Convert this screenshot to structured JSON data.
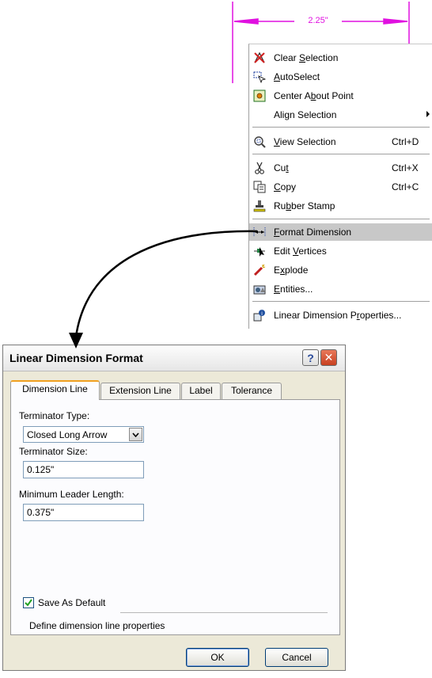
{
  "dimension": {
    "text": "2.25\"",
    "line_color": "#e010e0"
  },
  "context_menu": {
    "items": [
      {
        "label_pre": "Clear ",
        "label_ul": "S",
        "label_post": "election",
        "shortcut": "",
        "icon": "clear-selection-icon"
      },
      {
        "label_pre": "",
        "label_ul": "A",
        "label_post": "utoSelect",
        "shortcut": "",
        "icon": "autoselect-icon"
      },
      {
        "label_pre": "Center A",
        "label_ul": "b",
        "label_post": "out Point",
        "shortcut": "",
        "icon": "center-point-icon"
      },
      {
        "label_pre": "Ali",
        "label_ul": "g",
        "label_post": "n Selection",
        "shortcut": "",
        "icon": "",
        "submenu": true
      },
      {
        "label_pre": "",
        "label_ul": "V",
        "label_post": "iew Selection",
        "shortcut": "Ctrl+D",
        "icon": "view-selection-icon"
      },
      {
        "label_pre": "Cu",
        "label_ul": "t",
        "label_post": "",
        "shortcut": "Ctrl+X",
        "icon": "scissors-icon"
      },
      {
        "label_pre": "",
        "label_ul": "C",
        "label_post": "opy",
        "shortcut": "Ctrl+C",
        "icon": "copy-icon"
      },
      {
        "label_pre": "Ru",
        "label_ul": "b",
        "label_post": "ber Stamp",
        "shortcut": "",
        "icon": "stamp-icon"
      },
      {
        "label_pre": "",
        "label_ul": "F",
        "label_post": "ormat Dimension",
        "shortcut": "",
        "icon": "format-dimension-icon",
        "highlighted": true
      },
      {
        "label_pre": "Edit ",
        "label_ul": "V",
        "label_post": "ertices",
        "shortcut": "",
        "icon": "edit-vertices-icon"
      },
      {
        "label_pre": "E",
        "label_ul": "x",
        "label_post": "plode",
        "shortcut": "",
        "icon": "explode-icon"
      },
      {
        "label_pre": "",
        "label_ul": "E",
        "label_post": "ntities...",
        "shortcut": "",
        "icon": "entities-icon"
      },
      {
        "label_pre": "Linear Dimension P",
        "label_ul": "r",
        "label_post": "operties...",
        "shortcut": "",
        "icon": "properties-icon"
      }
    ]
  },
  "dialog": {
    "title": "Linear Dimension Format",
    "help_label": "?",
    "close_label": "✕",
    "tabs": [
      "Dimension Line",
      "Extension Line",
      "Label",
      "Tolerance"
    ],
    "active_tab": "Dimension Line",
    "terminator_type_label": "Terminator Type:",
    "terminator_type_value": "Closed Long Arrow",
    "terminator_size_label": "Terminator Size:",
    "terminator_size_value": "0.125\"",
    "min_leader_label": "Minimum Leader Length:",
    "min_leader_value": "0.375\"",
    "save_default_label": "Save As Default",
    "save_default_checked": true,
    "description": "Define dimension line properties",
    "ok_label": "OK",
    "cancel_label": "Cancel"
  }
}
